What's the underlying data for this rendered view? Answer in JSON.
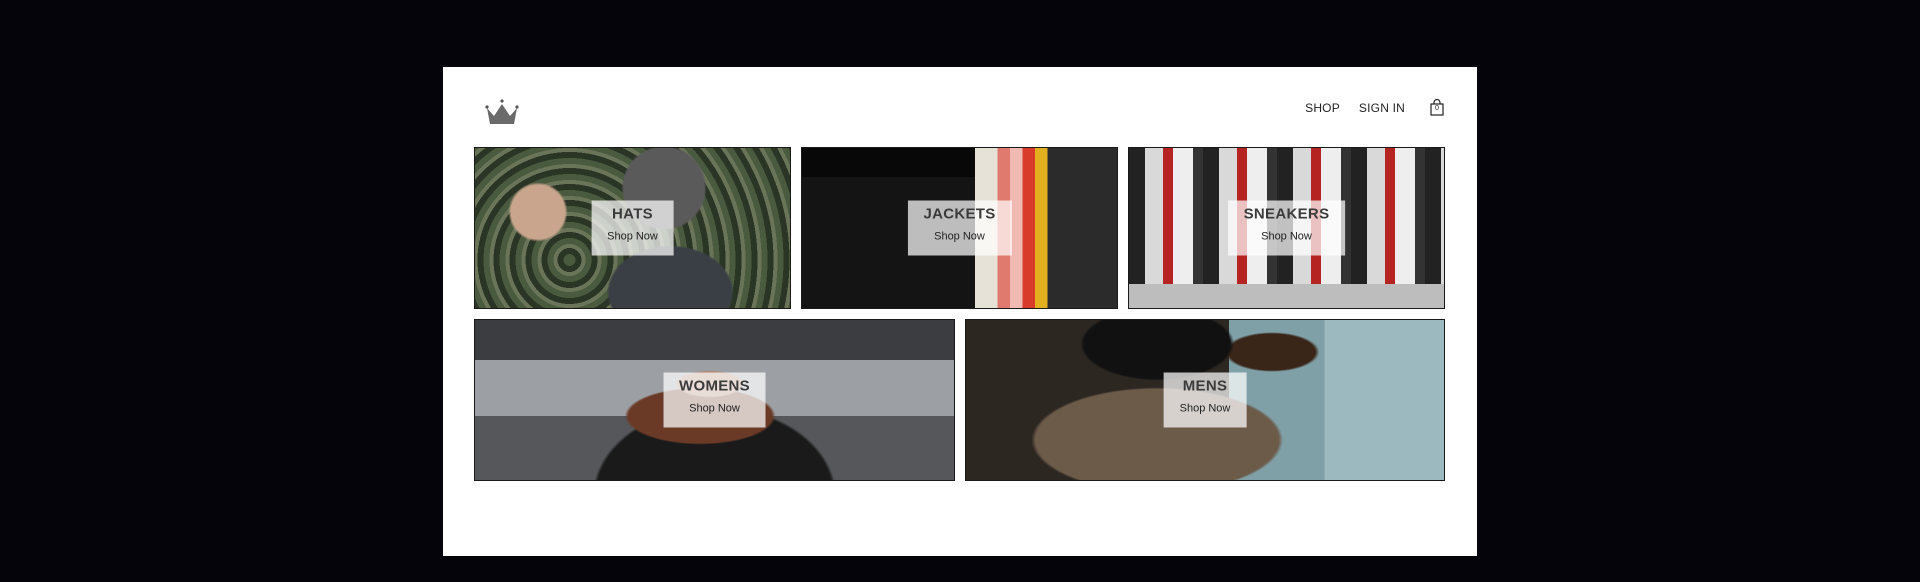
{
  "header": {
    "logo_icon": "crown-icon",
    "nav": {
      "shop_label": "SHOP",
      "signin_label": "SIGN IN",
      "cart_count": "0",
      "cart_icon": "shopping-bag-icon"
    }
  },
  "categories": [
    {
      "title": "HATS",
      "cta": "Shop Now"
    },
    {
      "title": "JACKETS",
      "cta": "Shop Now"
    },
    {
      "title": "SNEAKERS",
      "cta": "Shop Now"
    },
    {
      "title": "WOMENS",
      "cta": "Shop Now"
    },
    {
      "title": "MENS",
      "cta": "Shop Now"
    }
  ],
  "colors": {
    "outer_background": "#05040b",
    "page_background": "#ffffff",
    "label_box": "rgba(255,255,255,0.72)",
    "title_text": "#3b3b3b"
  }
}
